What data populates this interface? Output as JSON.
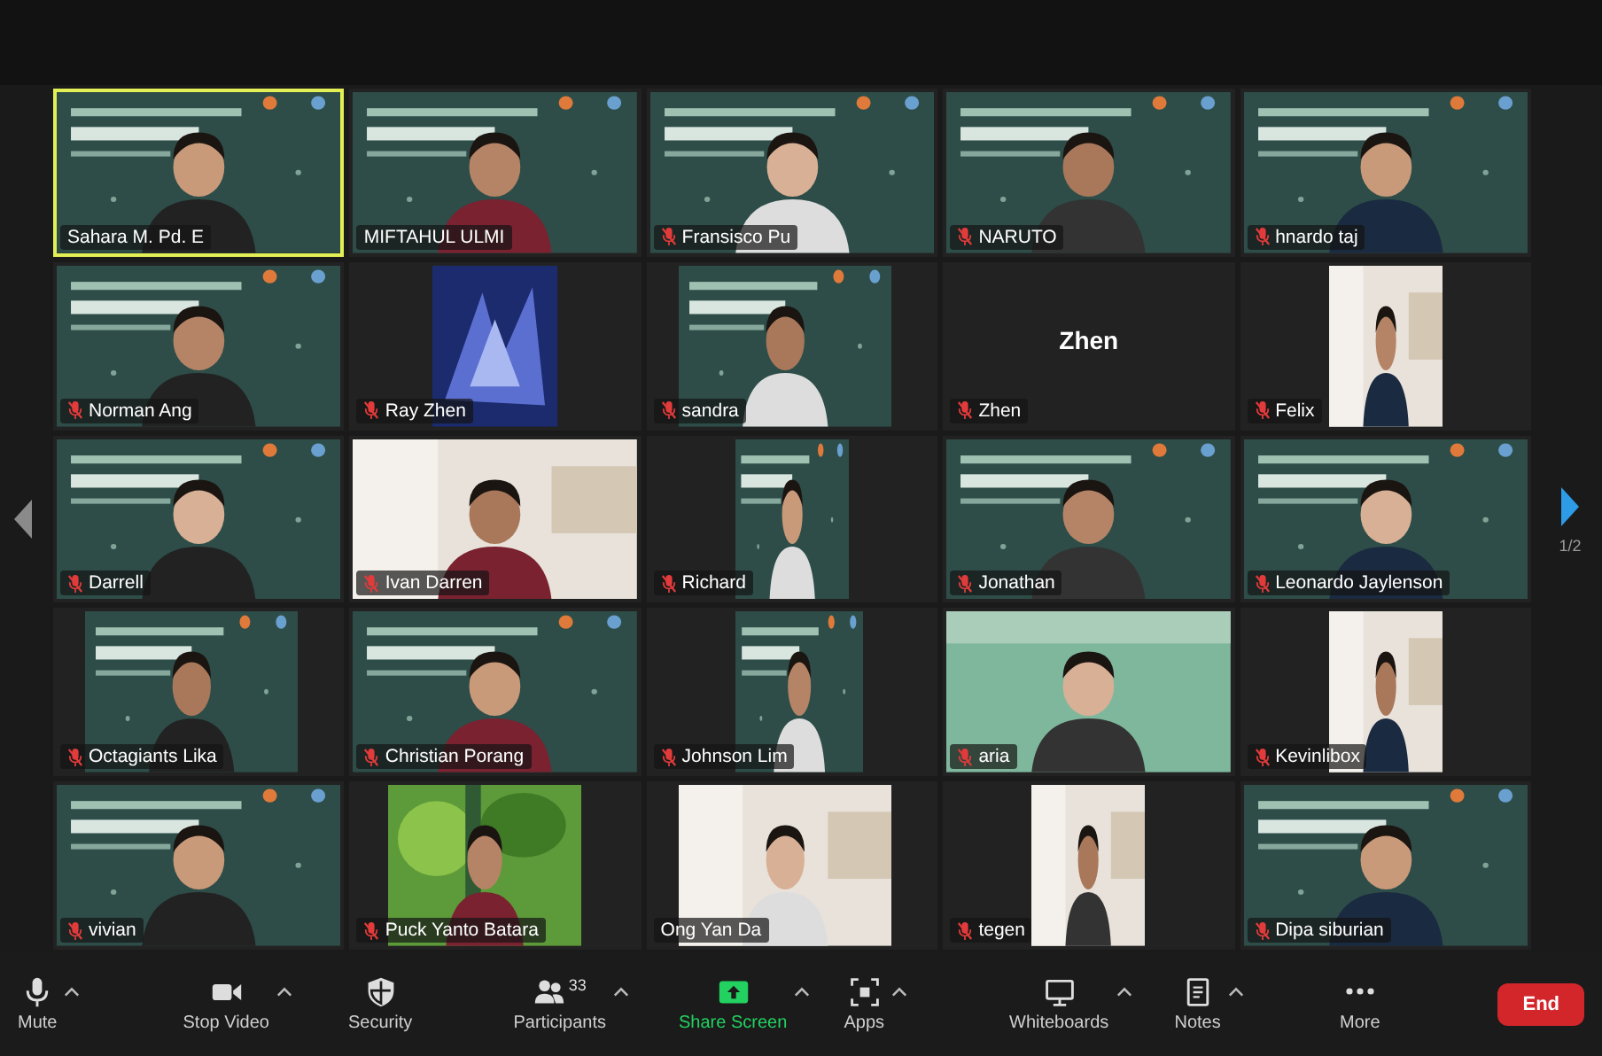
{
  "tiles": [
    {
      "name": "Sahara M. Pd. E",
      "muted": false,
      "selected": true,
      "kind": "video"
    },
    {
      "name": "MIFTAHUL ULMI",
      "muted": false,
      "selected": false,
      "kind": "video"
    },
    {
      "name": "Fransisco Pu",
      "muted": true,
      "selected": false,
      "kind": "video"
    },
    {
      "name": "NARUTO",
      "muted": true,
      "selected": false,
      "kind": "video"
    },
    {
      "name": "hnardo taj",
      "muted": true,
      "selected": false,
      "kind": "video"
    },
    {
      "name": "Norman Ang",
      "muted": true,
      "selected": false,
      "kind": "video"
    },
    {
      "name": "Ray Zhen",
      "muted": true,
      "selected": false,
      "kind": "video"
    },
    {
      "name": "sandra",
      "muted": true,
      "selected": false,
      "kind": "video"
    },
    {
      "name": "Zhen",
      "muted": true,
      "selected": false,
      "kind": "avatar",
      "display": "Zhen"
    },
    {
      "name": "Felix",
      "muted": true,
      "selected": false,
      "kind": "video"
    },
    {
      "name": "Darrell",
      "muted": true,
      "selected": false,
      "kind": "video"
    },
    {
      "name": "Ivan Darren",
      "muted": true,
      "selected": false,
      "kind": "video"
    },
    {
      "name": "Richard",
      "muted": true,
      "selected": false,
      "kind": "video"
    },
    {
      "name": "Jonathan",
      "muted": true,
      "selected": false,
      "kind": "video"
    },
    {
      "name": "Leonardo Jaylenson",
      "muted": true,
      "selected": false,
      "kind": "video"
    },
    {
      "name": "Octagiants Lika",
      "muted": true,
      "selected": false,
      "kind": "video"
    },
    {
      "name": "Christian Porang",
      "muted": true,
      "selected": false,
      "kind": "video"
    },
    {
      "name": "Johnson Lim",
      "muted": true,
      "selected": false,
      "kind": "video"
    },
    {
      "name": "aria",
      "muted": true,
      "selected": false,
      "kind": "video"
    },
    {
      "name": "Kevinlibox",
      "muted": true,
      "selected": false,
      "kind": "video"
    },
    {
      "name": "vivian",
      "muted": true,
      "selected": false,
      "kind": "video"
    },
    {
      "name": "Puck Yanto Batara",
      "muted": true,
      "selected": false,
      "kind": "video"
    },
    {
      "name": "Ong Yan Da",
      "muted": false,
      "selected": false,
      "kind": "video"
    },
    {
      "name": "tegen",
      "muted": true,
      "selected": false,
      "kind": "video"
    },
    {
      "name": "Dipa siburian",
      "muted": true,
      "selected": false,
      "kind": "video"
    }
  ],
  "page_indicator": "1/2",
  "toolbar": [
    {
      "label": "Mute",
      "kind": "mic",
      "caret": true,
      "active": false
    },
    {
      "label": "Stop Video",
      "kind": "video",
      "caret": true,
      "active": false
    },
    {
      "label": "Security",
      "kind": "shield",
      "caret": false,
      "active": false
    },
    {
      "label": "Participants",
      "kind": "people",
      "caret": true,
      "active": false,
      "count": "33"
    },
    {
      "label": "Share Screen",
      "kind": "share",
      "caret": true,
      "active": true
    },
    {
      "label": "Apps",
      "kind": "apps",
      "caret": true,
      "active": false
    },
    {
      "label": "Whiteboards",
      "kind": "whiteboard",
      "caret": true,
      "active": false
    },
    {
      "label": "Notes",
      "kind": "notes",
      "caret": true,
      "active": false
    },
    {
      "label": "More",
      "kind": "more",
      "caret": false,
      "active": false
    }
  ],
  "end_button": "End"
}
